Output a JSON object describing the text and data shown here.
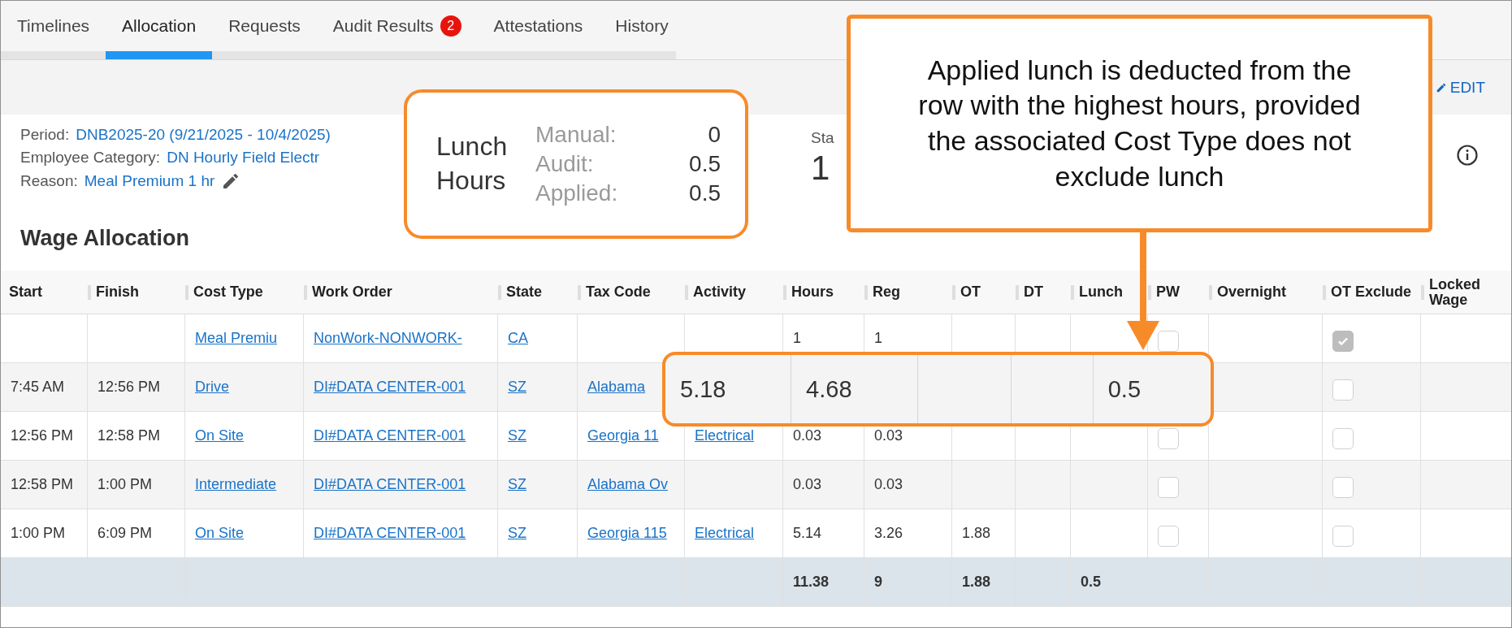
{
  "tabs": [
    {
      "label": "Timelines",
      "selected": false
    },
    {
      "label": "Allocation",
      "selected": true
    },
    {
      "label": "Requests",
      "selected": false
    },
    {
      "label": "Audit Results",
      "selected": false,
      "badge": "2"
    },
    {
      "label": "Attestations",
      "selected": false
    },
    {
      "label": "History",
      "selected": false
    }
  ],
  "toolbar": {
    "edit_button": "EDIT"
  },
  "details": [
    {
      "label": "Period:",
      "value": "DNB2025-20 (9/21/2025 - 10/4/2025)",
      "editable": false
    },
    {
      "label": "Employee Category:",
      "value": "DN Hourly Field Electr",
      "editable": false
    },
    {
      "label": "Reason:",
      "value": "Meal Premium 1 hr",
      "editable": true
    }
  ],
  "stat": {
    "label": "Sta",
    "value": "1"
  },
  "section_title": "Wage Allocation",
  "table": {
    "columns": [
      {
        "label": "Start",
        "kind": "text"
      },
      {
        "label": "Finish",
        "kind": "text"
      },
      {
        "label": "Cost Type",
        "kind": "link"
      },
      {
        "label": "Work Order",
        "kind": "link"
      },
      {
        "label": "State",
        "kind": "link"
      },
      {
        "label": "Tax Code",
        "kind": "link"
      },
      {
        "label": "Activity",
        "kind": "link"
      },
      {
        "label": "Hours",
        "kind": "text"
      },
      {
        "label": "Reg",
        "kind": "text"
      },
      {
        "label": "OT",
        "kind": "text"
      },
      {
        "label": "DT",
        "kind": "text"
      },
      {
        "label": "Lunch",
        "kind": "text"
      },
      {
        "label": "PW",
        "kind": "check"
      },
      {
        "label": "Overnight",
        "kind": "text"
      },
      {
        "label": "OT Exclude",
        "kind": "check"
      },
      {
        "label": "Locked Wage",
        "kind": "text"
      }
    ],
    "rows": [
      {
        "cost_type": "Meal Premiu",
        "work_order": "NonWork-NONWORK-",
        "state": "CA",
        "hours": "1",
        "reg": "1",
        "pw": {
          "checked": false
        },
        "ot_exclude": {
          "checked": true
        }
      },
      {
        "magnified": true,
        "start": "7:45 AM",
        "finish": "12:56 PM",
        "cost_type": "Drive",
        "work_order": "DI#DATA CENTER-001",
        "state": "SZ",
        "tax_code": "Alabama",
        "ot_exclude": {
          "checked": false
        }
      },
      {
        "start": "12:56 PM",
        "finish": "12:58 PM",
        "cost_type": "On Site",
        "work_order": "DI#DATA CENTER-001",
        "state": "SZ",
        "tax_code": "Georgia 11",
        "activity": "Electrical",
        "hours": "0.03",
        "reg": "0.03",
        "pw": {
          "checked": false
        },
        "ot_exclude": {
          "checked": false
        }
      },
      {
        "start": "12:58 PM",
        "finish": "1:00 PM",
        "cost_type": "Intermediate",
        "work_order": "DI#DATA CENTER-001",
        "state": "SZ",
        "tax_code": "Alabama Ov",
        "hours": "0.03",
        "reg": "0.03",
        "pw": {
          "checked": false
        },
        "ot_exclude": {
          "checked": false
        }
      },
      {
        "start": "1:00 PM",
        "finish": "6:09 PM",
        "cost_type": "On Site",
        "work_order": "DI#DATA CENTER-001",
        "state": "SZ",
        "tax_code": "Georgia 115",
        "activity": "Electrical",
        "hours": "5.14",
        "reg": "3.26",
        "ot": "1.88",
        "pw": {
          "checked": false
        },
        "ot_exclude": {
          "checked": false
        }
      }
    ],
    "totals": {
      "hours": "11.38",
      "reg": "9",
      "ot": "1.88",
      "lunch": "0.5"
    }
  },
  "annotations": {
    "lunch_hours": {
      "title": "Lunch Hours",
      "rows": [
        {
          "label": "Manual:",
          "value": "0"
        },
        {
          "label": "Audit:",
          "value": "0.5"
        },
        {
          "label": "Applied:",
          "value": "0.5"
        }
      ]
    },
    "callout": "Applied lunch is deducted from the row with the highest hours, provided the associated Cost Type does not exclude lunch",
    "magnified_row": {
      "hours": "5.18",
      "reg": "4.68",
      "lunch": "0.5"
    }
  }
}
